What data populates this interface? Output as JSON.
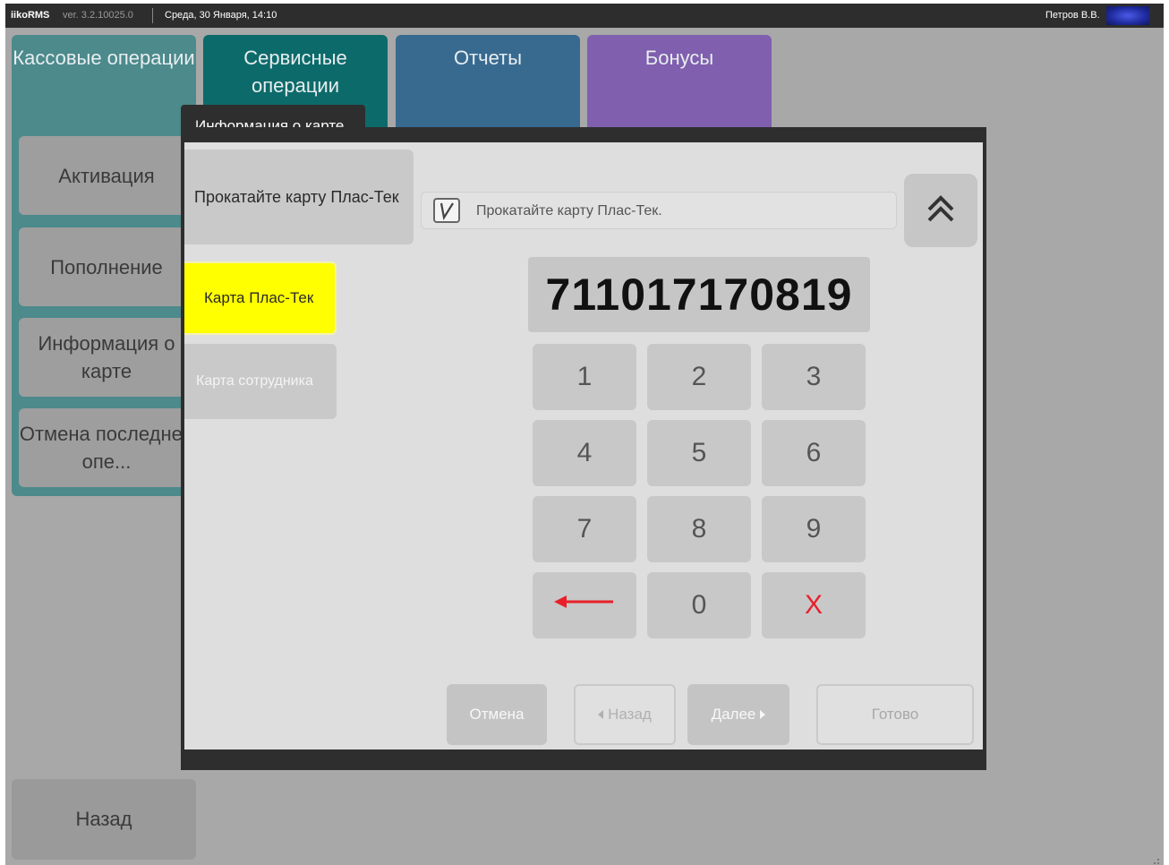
{
  "titlebar": {
    "app_name": "iikoRMS",
    "version": "ver. 3.2.10025.0",
    "datetime": "Среда, 30 Января, 14:10",
    "user": "Петров В.В."
  },
  "tabs": [
    {
      "label": "Кассовые операции"
    },
    {
      "label": "Сервисные операции"
    },
    {
      "label": "Отчеты"
    },
    {
      "label": "Бонусы"
    }
  ],
  "sidebar": {
    "items": [
      {
        "label": "Активация"
      },
      {
        "label": "Пополнение"
      },
      {
        "label": "Информация о карте"
      },
      {
        "label": "Отмена последней опе..."
      }
    ],
    "back_label": "Назад"
  },
  "dialog": {
    "title": "Информация о карте",
    "swipe_button_label": "Прокатайте карту Плас-Тек",
    "card_types": [
      {
        "label": "Карта Плас-Тек",
        "selected": true
      },
      {
        "label": "Карта сотрудника",
        "selected": false
      }
    ],
    "status_text": "Прокатайте карту Плас-Тек.",
    "card_number": "711017170819",
    "keypad": [
      "1",
      "2",
      "3",
      "4",
      "5",
      "6",
      "7",
      "8",
      "9",
      "0",
      "X"
    ],
    "buttons": {
      "cancel": "Отмена",
      "prev": "Назад",
      "next": "Далее",
      "done": "Готово"
    }
  },
  "colors": {
    "tab_kass": "#4c8a8c",
    "tab_serv": "#0d6a6a",
    "tab_otch": "#386a90",
    "tab_bon": "#7f5fae",
    "selected_card": "#ffff00",
    "clear_key": "#e8202a"
  },
  "icons": {
    "collapse": "double-chevron-up-icon",
    "backspace": "arrow-left-icon",
    "status": "checkbox-icon"
  }
}
